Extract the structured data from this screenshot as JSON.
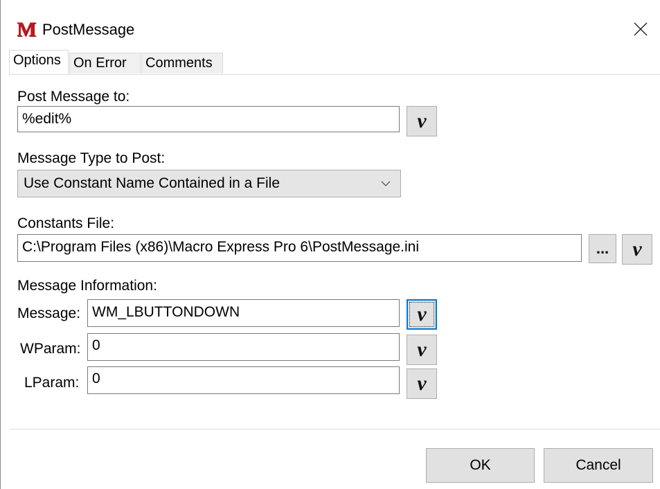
{
  "window": {
    "title": "PostMessage",
    "app_icon_letter": "M",
    "close_glyph": "close-icon"
  },
  "tabs": [
    {
      "label": "Options",
      "active": true
    },
    {
      "label": "On Error",
      "active": false
    },
    {
      "label": "Comments",
      "active": false
    }
  ],
  "post_to": {
    "label": "Post Message to:",
    "value": "%edit%",
    "var_button": "v"
  },
  "message_type": {
    "label": "Message Type to Post:",
    "selected": "Use Constant Name Contained in a File"
  },
  "constants_file": {
    "label": "Constants File:",
    "value": "C:\\Program Files (x86)\\Macro Express Pro 6\\PostMessage.ini",
    "browse_label": "...",
    "var_button": "v"
  },
  "message_info": {
    "label": "Message Information:",
    "message": {
      "label": "Message:",
      "value": "WM_LBUTTONDOWN",
      "var_button": "v"
    },
    "wparam": {
      "label": "WParam:",
      "value": "0",
      "var_button": "v"
    },
    "lparam": {
      "label": "LParam:",
      "value": "0",
      "var_button": "v"
    }
  },
  "buttons": {
    "ok": "OK",
    "cancel": "Cancel"
  },
  "colors": {
    "icon_red": "#c8161d",
    "focus_blue": "#0078d7"
  }
}
